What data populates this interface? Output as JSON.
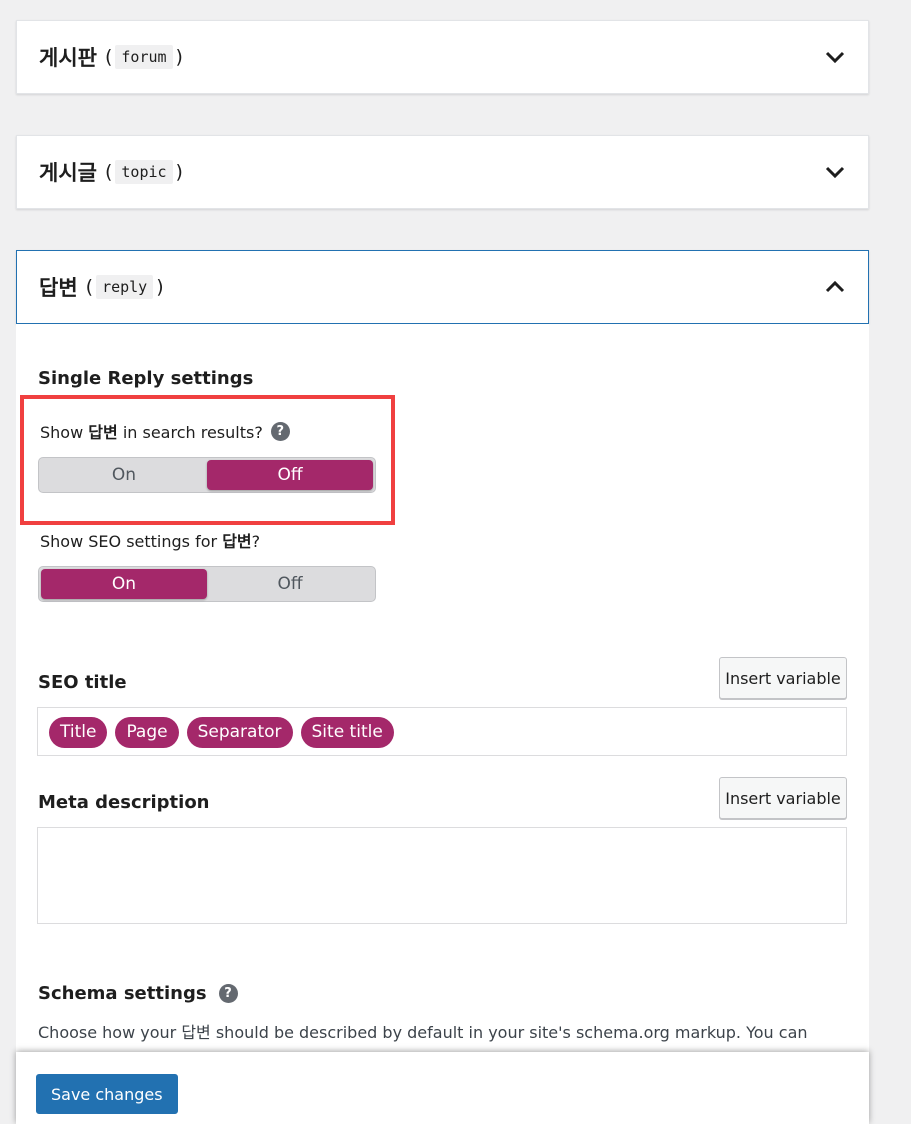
{
  "accordions": [
    {
      "title": "게시판",
      "code": "forum",
      "expanded": false
    },
    {
      "title": "게시글",
      "code": "topic",
      "expanded": false
    },
    {
      "title": "답변",
      "code": "reply",
      "expanded": true
    }
  ],
  "section_title": "Single Reply settings",
  "search_results": {
    "label_pre": "Show",
    "label_bold": "답변",
    "label_post": "in search results?",
    "options": [
      "On",
      "Off"
    ],
    "selected": "Off"
  },
  "seo_settings": {
    "label_pre": "Show SEO settings for",
    "label_bold": "답변",
    "label_post": "?",
    "options": [
      "On",
      "Off"
    ],
    "selected": "On"
  },
  "seo_title": {
    "label": "SEO title",
    "insert_label": "Insert variable",
    "variables": [
      "Title",
      "Page",
      "Separator",
      "Site title"
    ]
  },
  "meta_description": {
    "label": "Meta description",
    "insert_label": "Insert variable",
    "value": ""
  },
  "schema": {
    "label": "Schema settings",
    "description": "Choose how your 답변 should be described by default in your site's schema.org markup. You can change"
  },
  "footer": {
    "save_label": "Save changes"
  },
  "colors": {
    "accent": "#a4286a",
    "primary": "#2271b1",
    "highlight": "#f04040"
  }
}
